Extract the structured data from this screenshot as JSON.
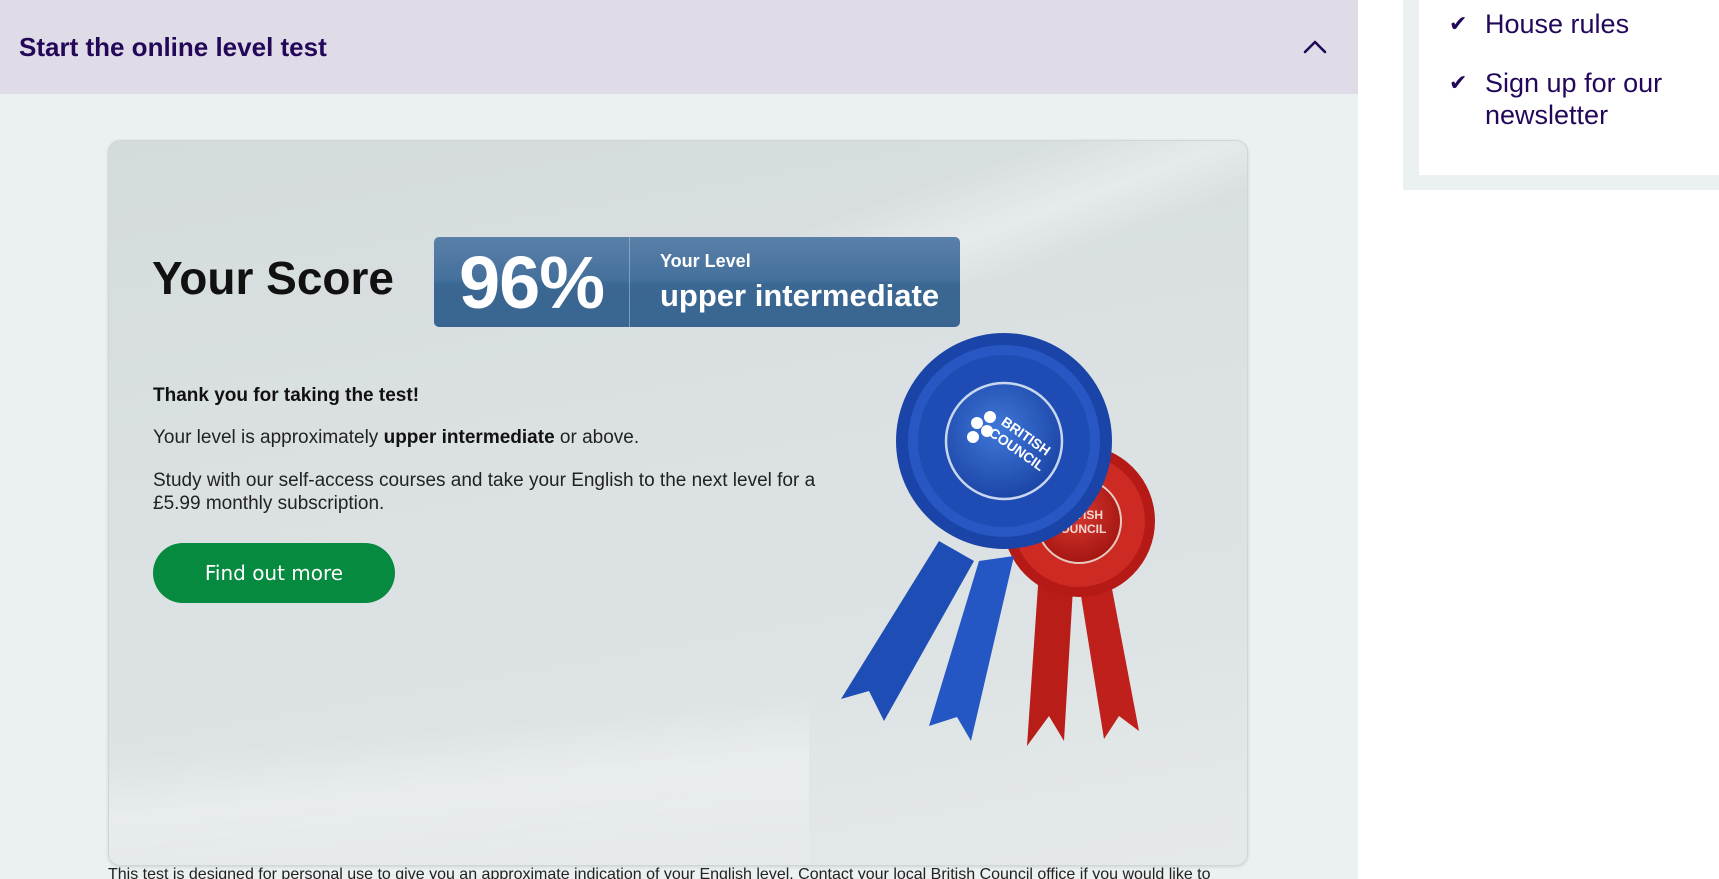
{
  "accordion": {
    "title": "Start the online level test"
  },
  "result": {
    "score_heading": "Your Score",
    "score_percent": "96%",
    "level_label": "Your Level",
    "level_value": "upper intermediate",
    "thank_you": "Thank you for taking the test!",
    "level_line_prefix": "Your level is approximately ",
    "level_line_bold": "upper intermediate",
    "level_line_suffix": " or above.",
    "study_line": "Study with our self-access courses and take your English to the next level for a £5.99 monthly subscription.",
    "cta_label": "Find out more",
    "rosette_blue_text": [
      "BRITISH",
      "COUNCIL"
    ],
    "rosette_red_text": [
      "BRITISH",
      "COUNCIL"
    ]
  },
  "disclaimer": "This test is designed for personal use to give you an approximate indication of your English level. Contact your local British Council office if you would like to",
  "sidebar": {
    "items": [
      {
        "label": "House rules"
      },
      {
        "label": "Sign up for our newsletter"
      }
    ]
  },
  "colors": {
    "brand_purple": "#23085a",
    "cta_green": "#058a3f",
    "score_blue": "#44709c",
    "rosette_blue": "#1f4fb8",
    "rosette_red": "#c0201c"
  },
  "icons": {
    "accordion_toggle": "chevron-up-icon",
    "list_marker": "checkmark-icon"
  }
}
